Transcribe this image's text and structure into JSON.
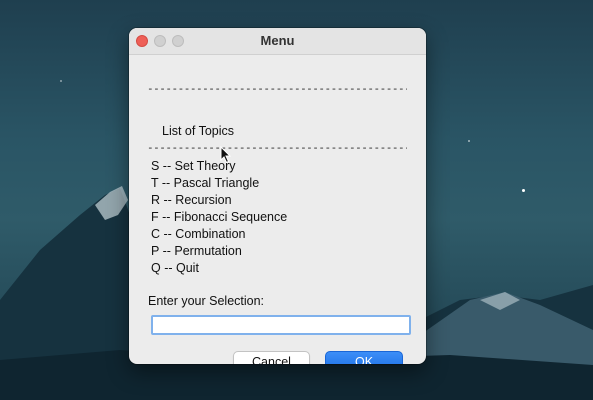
{
  "window": {
    "title": "Menu"
  },
  "menu": {
    "separator": "------------------------------------------------",
    "heading": "List of Topics",
    "topics": [
      "S -- Set Theory",
      "T -- Pascal Triangle",
      "R -- Recursion",
      "F -- Fibonacci Sequence",
      "C -- Combination",
      "P -- Permutation",
      "Q -- Quit"
    ]
  },
  "selection": {
    "label": "Enter your Selection:",
    "value": ""
  },
  "buttons": {
    "cancel_label": "Cancel",
    "ok_label": "OK"
  },
  "colors": {
    "ok_button": "#1b6fe5",
    "close_light": "#ee5f57",
    "input_focus": "#7fb1ec"
  }
}
